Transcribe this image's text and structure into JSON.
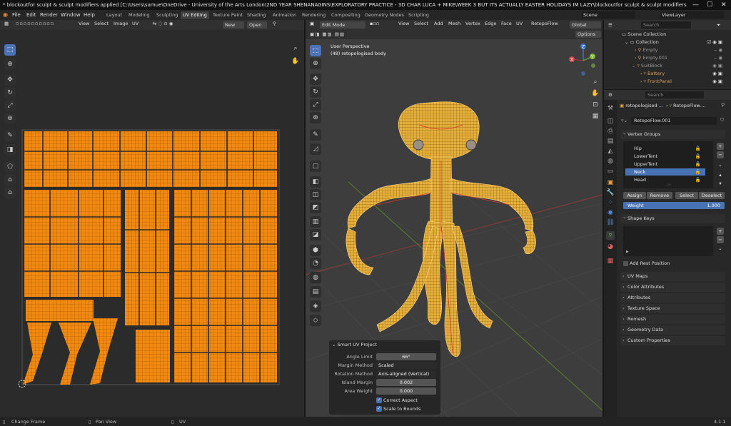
{
  "window": {
    "title": "* blockoutfor sculpt & sculpt modifiers applied [C:\\Users\\samue\\OneDrive - University of the Arts London\\2ND YEAR SHENANAGINS\\EXPLORATORY PRACTICE - 3D CHAR LUCA + MIKE\\WEEK 3 BUT ITS ACTUALLY EASTER HOLIDAYS IM LAZY\\blockoutfor sculpt & sculpt modifiers",
    "minimize": "—",
    "maximize": "☐",
    "close": "✕"
  },
  "menubar": {
    "items": [
      "File",
      "Edit",
      "Render",
      "Window",
      "Help"
    ],
    "workspaces": [
      "Layout",
      "Modeling",
      "Sculpting",
      "UV Editing",
      "Texture Paint",
      "Shading",
      "Animation",
      "Rendering",
      "Compositing",
      "Geometry Nodes",
      "Scripting"
    ],
    "active_workspace": "UV Editing",
    "scene": "Scene",
    "view_layer": "ViewLayer"
  },
  "uv_editor": {
    "menus": [
      "View",
      "Select",
      "Image",
      "UV"
    ],
    "new_label": "New",
    "open_label": "Open"
  },
  "viewport": {
    "mode": "Edit Mode",
    "menus": [
      "View",
      "Select",
      "Add",
      "Mesh",
      "Vertex",
      "Edge",
      "Face",
      "UV"
    ],
    "object_name": "RetopoFlow",
    "orientation": "Global",
    "options": "Options",
    "overlay_line1": "User Perspective",
    "overlay_line2": "(48) retopologised body",
    "gizmo": {
      "x": "X",
      "y": "Y",
      "z": "Z"
    }
  },
  "operator_panel": {
    "title": "Smart UV Project",
    "angle_limit_label": "Angle Limit",
    "angle_limit": "66°",
    "margin_method_label": "Margin Method",
    "margin_method": "Scaled",
    "rotation_method_label": "Rotation Method",
    "rotation_method": "Axis-aligned (Vertical)",
    "island_margin_label": "Island Margin",
    "island_margin": "0.002",
    "area_weight_label": "Area Weight",
    "area_weight": "0.000",
    "correct_aspect": "Correct Aspect",
    "scale_to_bounds": "Scale to Bounds"
  },
  "outliner": {
    "search_placeholder": "Search",
    "scene_collection": "Scene Collection",
    "collection": "Collection",
    "items": [
      "Empty",
      "Empty.001",
      "SuitBlock",
      "Battery",
      "FrontPanel"
    ]
  },
  "properties": {
    "search_placeholder": "Search",
    "breadcrumb_object": "retopologised ...",
    "breadcrumb_data": "RetopoFlow....",
    "mesh_name": "RetopoFlow.001",
    "vertex_groups_title": "Vertex Groups",
    "vertex_groups": [
      "Hip",
      "LowerTent",
      "UpperTent",
      "Neck",
      "Head"
    ],
    "selected_group": "Neck",
    "assign": "Assign",
    "remove": "Remove",
    "select": "Select",
    "deselect": "Deselect",
    "weight_label": "Weight",
    "weight_value": "1.000",
    "shape_keys_title": "Shape Keys",
    "add_rest_position": "Add Rest Position",
    "sections": [
      "UV Maps",
      "Color Attributes",
      "Attributes",
      "Texture Space",
      "Remesh",
      "Geometry Data",
      "Custom Properties"
    ]
  },
  "statusbar": {
    "change_frame": "Change Frame",
    "pan_view": "Pan View",
    "uv": "UV",
    "version": "4.1.1"
  },
  "colors": {
    "uv_orange": "#f28a12",
    "mesh_yellow": "#e8b03a",
    "select_blue": "#4772b3",
    "seam_red": "#d63a2a"
  }
}
